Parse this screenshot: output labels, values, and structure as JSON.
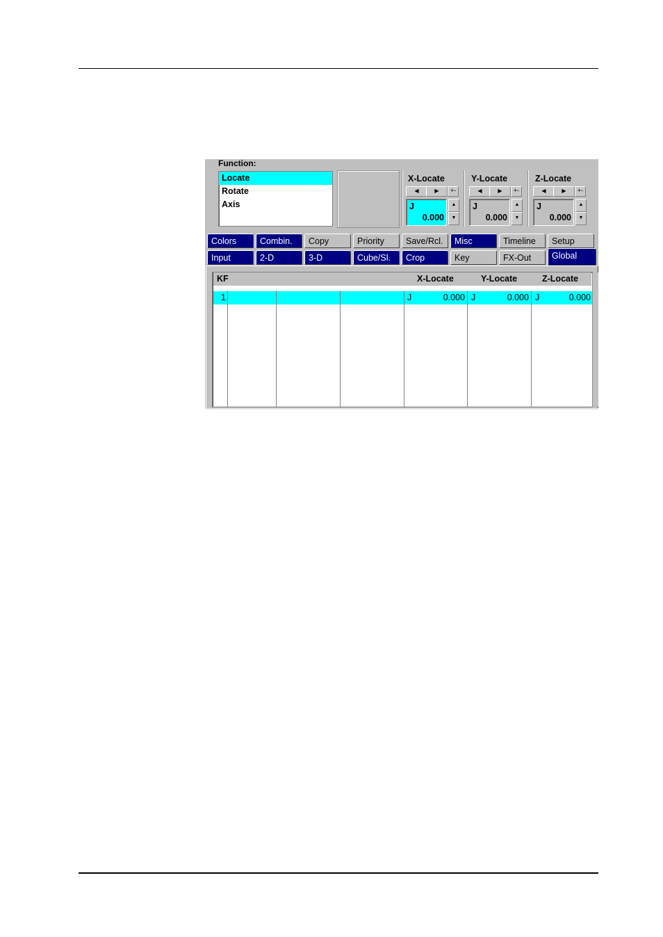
{
  "panel": {
    "function_label": "Function:",
    "functions": [
      {
        "label": "Locate",
        "selected": true
      },
      {
        "label": "Rotate",
        "selected": false
      },
      {
        "label": "Axis",
        "selected": false
      }
    ],
    "locate_groups": [
      {
        "title": "X-Locate",
        "mode": "J",
        "value": "0.000",
        "active": true
      },
      {
        "title": "Y-Locate",
        "mode": "J",
        "value": "0.000",
        "active": false
      },
      {
        "title": "Z-Locate",
        "mode": "J",
        "value": "0.000",
        "active": false
      }
    ],
    "icons": {
      "left": "◀",
      "right": "▶",
      "plusminus": "+-",
      "up": "▲",
      "down": "▼"
    },
    "tabs_row1": [
      {
        "label": "Colors",
        "dark": true
      },
      {
        "label": "Combin.",
        "dark": true
      },
      {
        "label": "Copy",
        "dark": false
      },
      {
        "label": "Priority",
        "dark": false
      },
      {
        "label": "Save/Rcl.",
        "dark": false
      },
      {
        "label": "Misc",
        "dark": true
      },
      {
        "label": "Timeline",
        "dark": false
      },
      {
        "label": "Setup",
        "dark": false
      }
    ],
    "tabs_row2": [
      {
        "label": "Input",
        "dark": true
      },
      {
        "label": "2-D",
        "dark": true
      },
      {
        "label": "3-D",
        "dark": true
      },
      {
        "label": "Cube/Sl.",
        "dark": true
      },
      {
        "label": "Crop",
        "dark": true
      },
      {
        "label": "Key",
        "dark": false
      },
      {
        "label": "FX-Out",
        "dark": false
      },
      {
        "label": "Global",
        "dark": true,
        "active": true
      }
    ],
    "grid": {
      "headers": {
        "kf": "KF",
        "x": "X-Locate",
        "y": "Y-Locate",
        "z": "Z-Locate"
      },
      "rows": [
        {
          "kf": "1",
          "x_mode": "J",
          "x": "0.000",
          "y_mode": "J",
          "y": "0.000",
          "z_mode": "J",
          "z": "0.000"
        }
      ]
    },
    "colors": {
      "selection": "#00ffff",
      "tab_dark": "#000080",
      "panel": "#c0c0c0"
    }
  }
}
